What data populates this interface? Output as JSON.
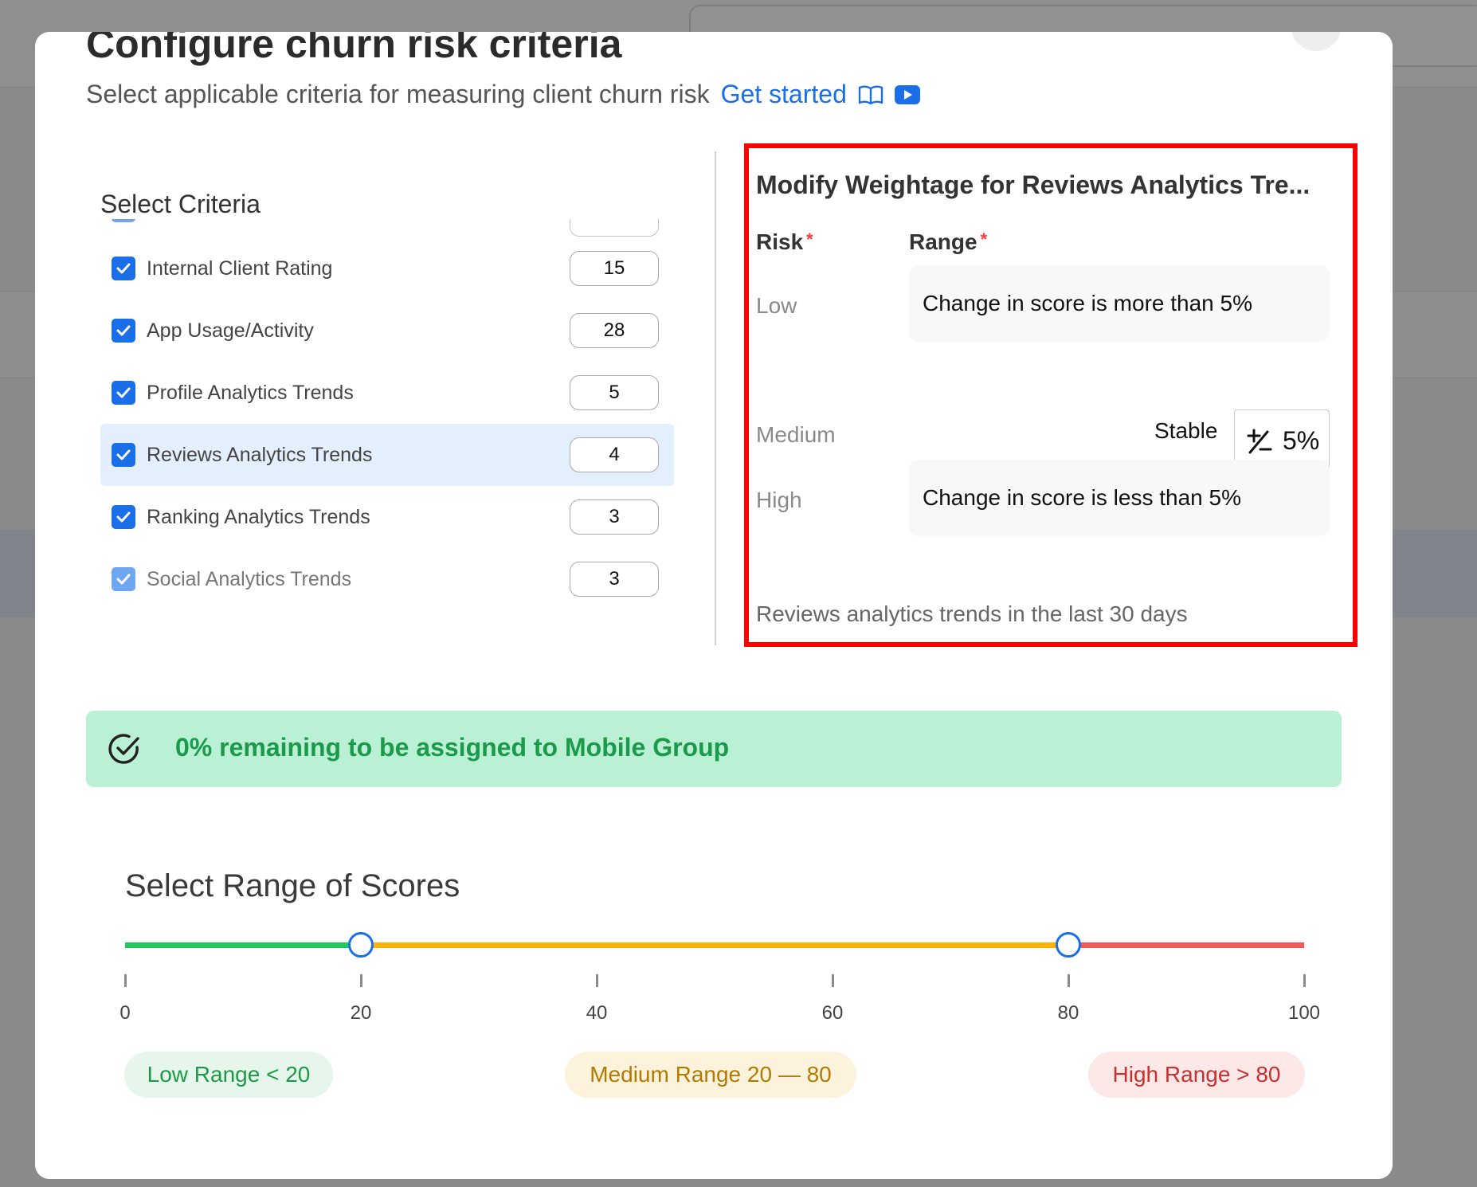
{
  "modal": {
    "title": "Configure churn risk criteria",
    "subtitle": "Select applicable criteria for measuring client churn risk",
    "get_started": "Get started"
  },
  "icons": {
    "book": "book-open-icon",
    "video": "youtube-play-icon",
    "check": "checkbox-checked-icon",
    "plus_minus": "plus-minus-icon",
    "banner": "check-circle-icon"
  },
  "criteria": {
    "heading": "Select Criteria",
    "items": [
      {
        "label": "Internal Client Rating",
        "weight": "15",
        "checked": true
      },
      {
        "label": "App Usage/Activity",
        "weight": "28",
        "checked": true
      },
      {
        "label": "Profile Analytics Trends",
        "weight": "5",
        "checked": true
      },
      {
        "label": "Reviews Analytics Trends",
        "weight": "4",
        "checked": true,
        "selected": true
      },
      {
        "label": "Ranking Analytics Trends",
        "weight": "3",
        "checked": true
      },
      {
        "label": "Social Analytics Trends",
        "weight": "3",
        "checked": true,
        "disabled": true
      }
    ]
  },
  "weightage": {
    "title": "Modify Weightage for Reviews Analytics Tre...",
    "col_risk": "Risk",
    "col_range": "Range",
    "required_mark": "*",
    "rows": {
      "low": {
        "risk": "Low",
        "range": "Change in score is more than 5%"
      },
      "medium": {
        "risk": "Medium",
        "stable_label": "Stable",
        "value": "5%"
      },
      "high": {
        "risk": "High",
        "range": "Change in score is less than 5%"
      }
    },
    "footnote": "Reviews analytics trends in the last 30 days"
  },
  "banner": {
    "text": "0% remaining to be assigned to Mobile Group"
  },
  "score_range": {
    "title": "Select Range of Scores",
    "min": 0,
    "max": 100,
    "low_handle": 20,
    "high_handle": 80,
    "ticks": [
      "0",
      "20",
      "40",
      "60",
      "80",
      "100"
    ],
    "colors": {
      "low": "#22c55e",
      "medium": "#fbb20a",
      "high": "#f25a5a"
    },
    "chips": {
      "low": "Low Range < 20",
      "medium": "Medium Range 20 — 80",
      "high": "High Range > 80"
    }
  }
}
